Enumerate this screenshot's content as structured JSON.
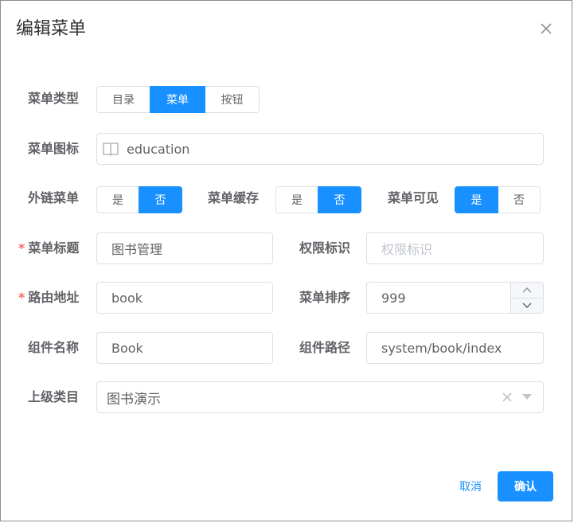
{
  "dialog": {
    "title": "编辑菜单"
  },
  "fields": {
    "menu_type": {
      "label": "菜单类型",
      "options": [
        "目录",
        "菜单",
        "按钮"
      ],
      "selected": "菜单"
    },
    "menu_icon": {
      "label": "菜单图标",
      "value": "education",
      "icon": "book-icon"
    },
    "external_link": {
      "label": "外链菜单",
      "options": [
        "是",
        "否"
      ],
      "selected": "否"
    },
    "menu_cache": {
      "label": "菜单缓存",
      "options": [
        "是",
        "否"
      ],
      "selected": "否"
    },
    "menu_visible": {
      "label": "菜单可见",
      "options": [
        "是",
        "否"
      ],
      "selected": "是"
    },
    "menu_title": {
      "label": "菜单标题",
      "required": "*",
      "value": "图书管理"
    },
    "permission": {
      "label": "权限标识",
      "placeholder": "权限标识"
    },
    "route_path": {
      "label": "路由地址",
      "required": "*",
      "value": "book"
    },
    "sort": {
      "label": "菜单排序",
      "value": "999"
    },
    "component_name": {
      "label": "组件名称",
      "value": "Book"
    },
    "component_path": {
      "label": "组件路径",
      "value": "system/book/index"
    },
    "parent": {
      "label": "上级类目",
      "value": "图书演示"
    }
  },
  "footer": {
    "cancel_label": "取消",
    "confirm_label": "确认"
  },
  "colors": {
    "primary": "#1890ff",
    "required": "#f56c6c",
    "border": "#dcdfe6"
  }
}
